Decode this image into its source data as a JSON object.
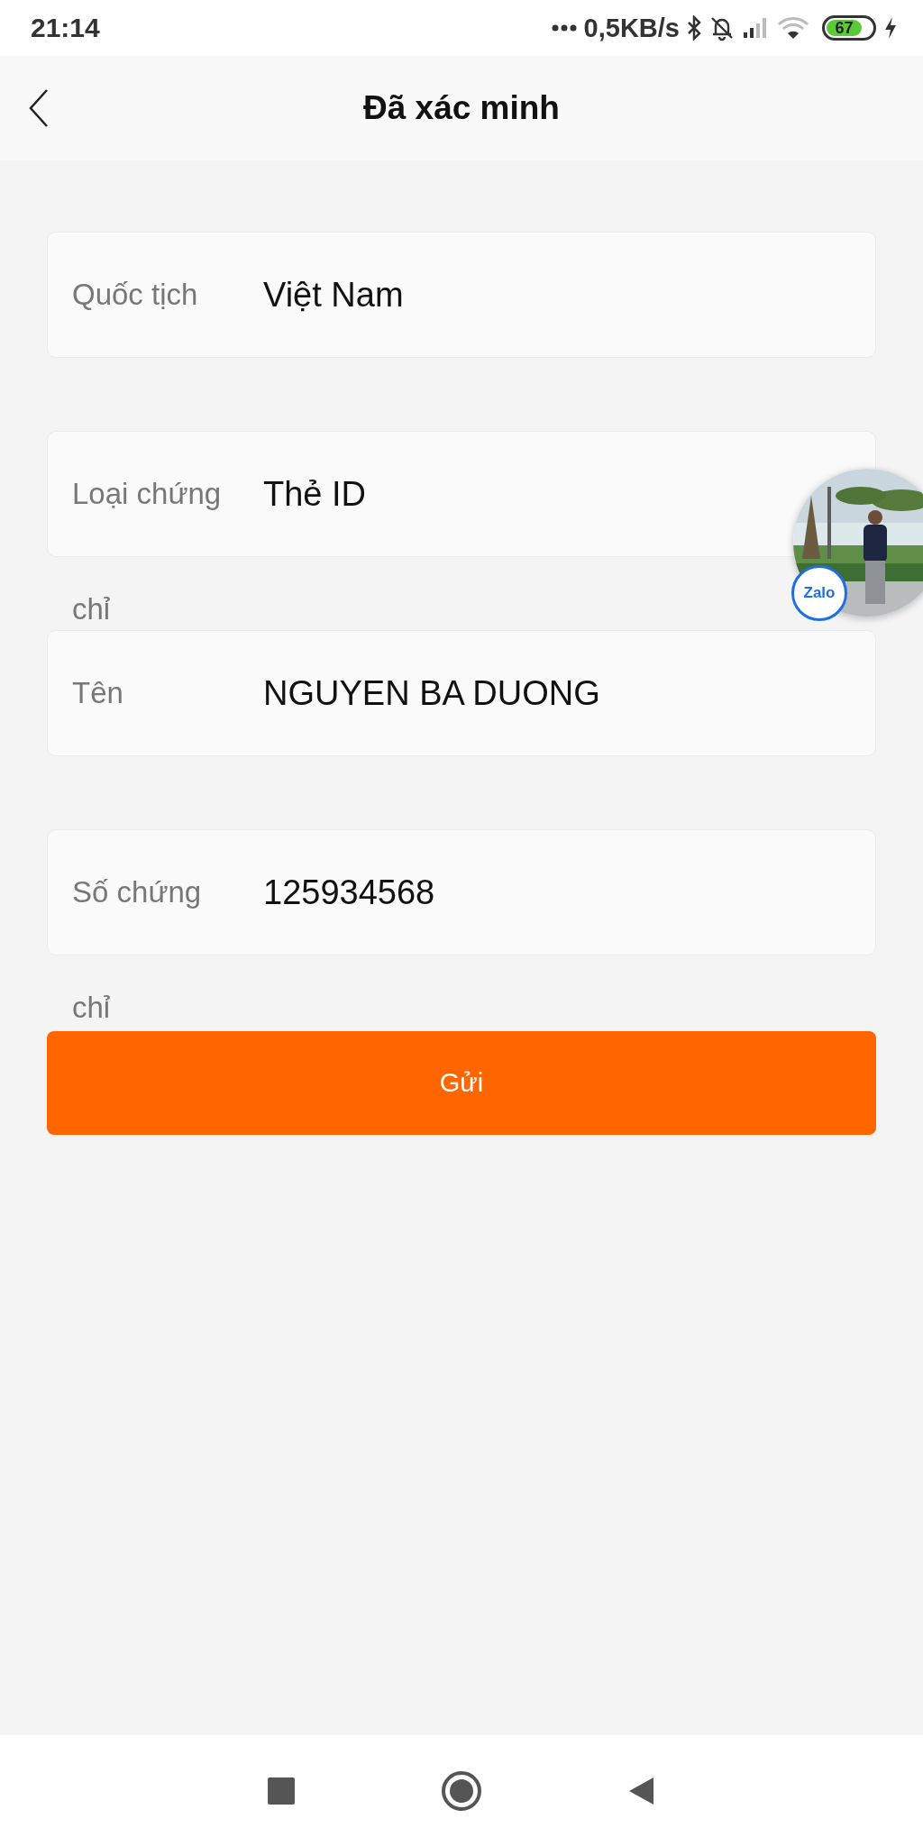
{
  "status_bar": {
    "time": "21:14",
    "network_speed": "0,5KB/s",
    "battery": "67"
  },
  "header": {
    "title": "Đã xác minh"
  },
  "fields": [
    {
      "label": "Quốc tịch",
      "value": "Việt Nam"
    },
    {
      "label": "Loại chứng",
      "label_continued": "chỉ",
      "value": "Thẻ ID"
    },
    {
      "label": "Tên",
      "value": "NGUYEN BA DUONG"
    },
    {
      "label": "Số chứng",
      "label_continued": "chỉ",
      "value": "125934568"
    }
  ],
  "submit_button": {
    "label": "Gửi"
  },
  "floating_bubble": {
    "kind": "picture",
    "badge": "Zalo"
  }
}
